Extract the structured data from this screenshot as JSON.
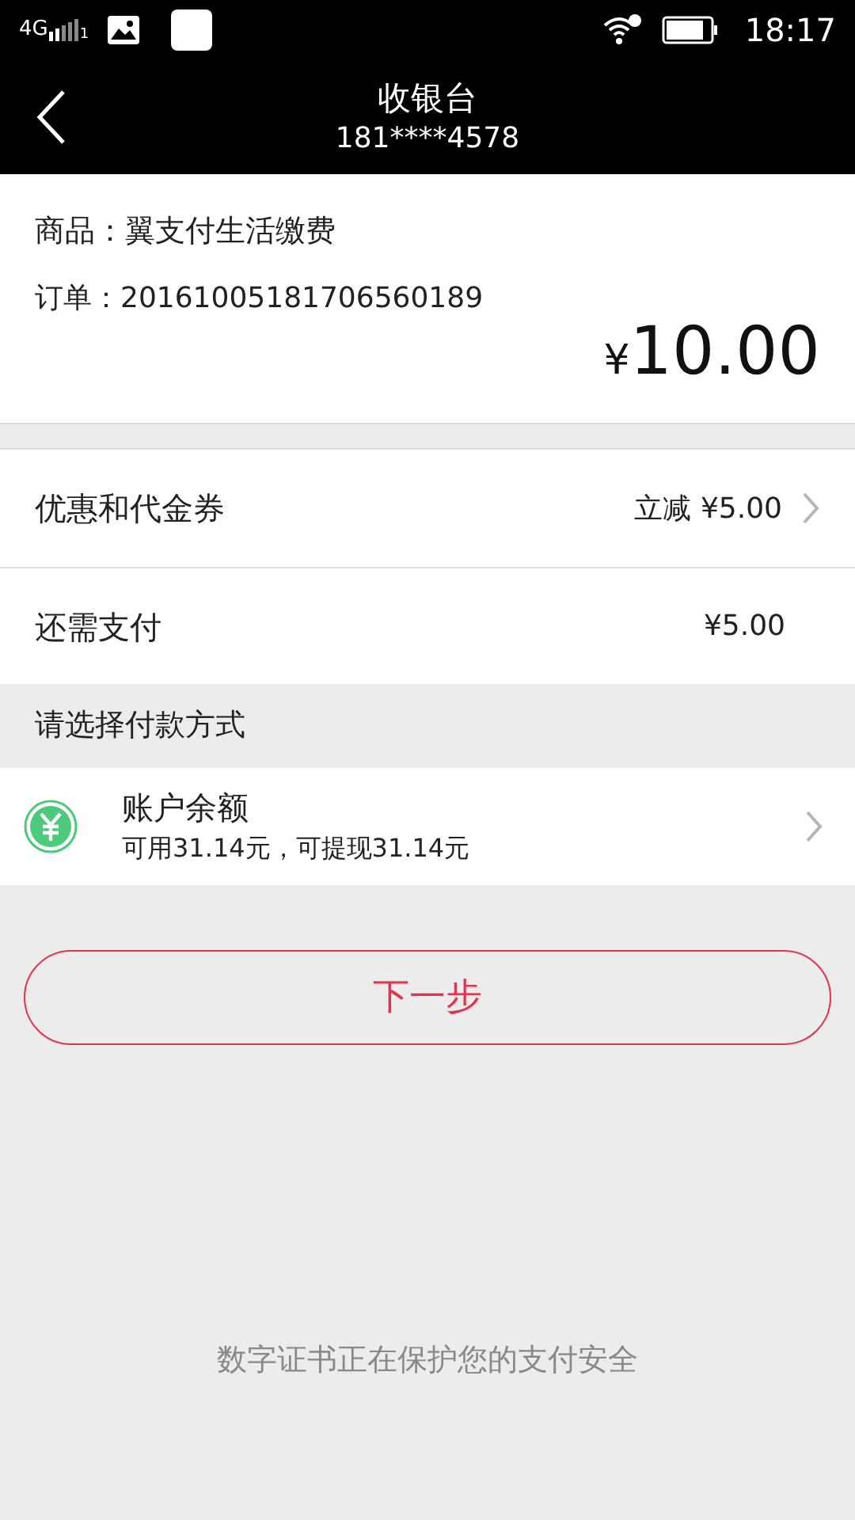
{
  "status_bar": {
    "network": "4G",
    "sim": "1",
    "time": "18:17"
  },
  "header": {
    "title": "收银台",
    "subtitle": "181****4578"
  },
  "order": {
    "product": "商品：翼支付生活缴费",
    "order_no": "订单：20161005181706560189",
    "amount": "¥10.00"
  },
  "rows": [
    {
      "label": "优惠和代金券",
      "value": "立减 ¥5.00",
      "chevron": true
    },
    {
      "label": "还需支付",
      "value": "¥5.00",
      "chevron": false
    }
  ],
  "payment_section": {
    "title": "请选择付款方式",
    "method": {
      "name": "账户余额",
      "detail": "可用31.14元，可提现31.14元"
    }
  },
  "next_button": "下一步",
  "footer": "数字证书正在保护您的支付安全"
}
